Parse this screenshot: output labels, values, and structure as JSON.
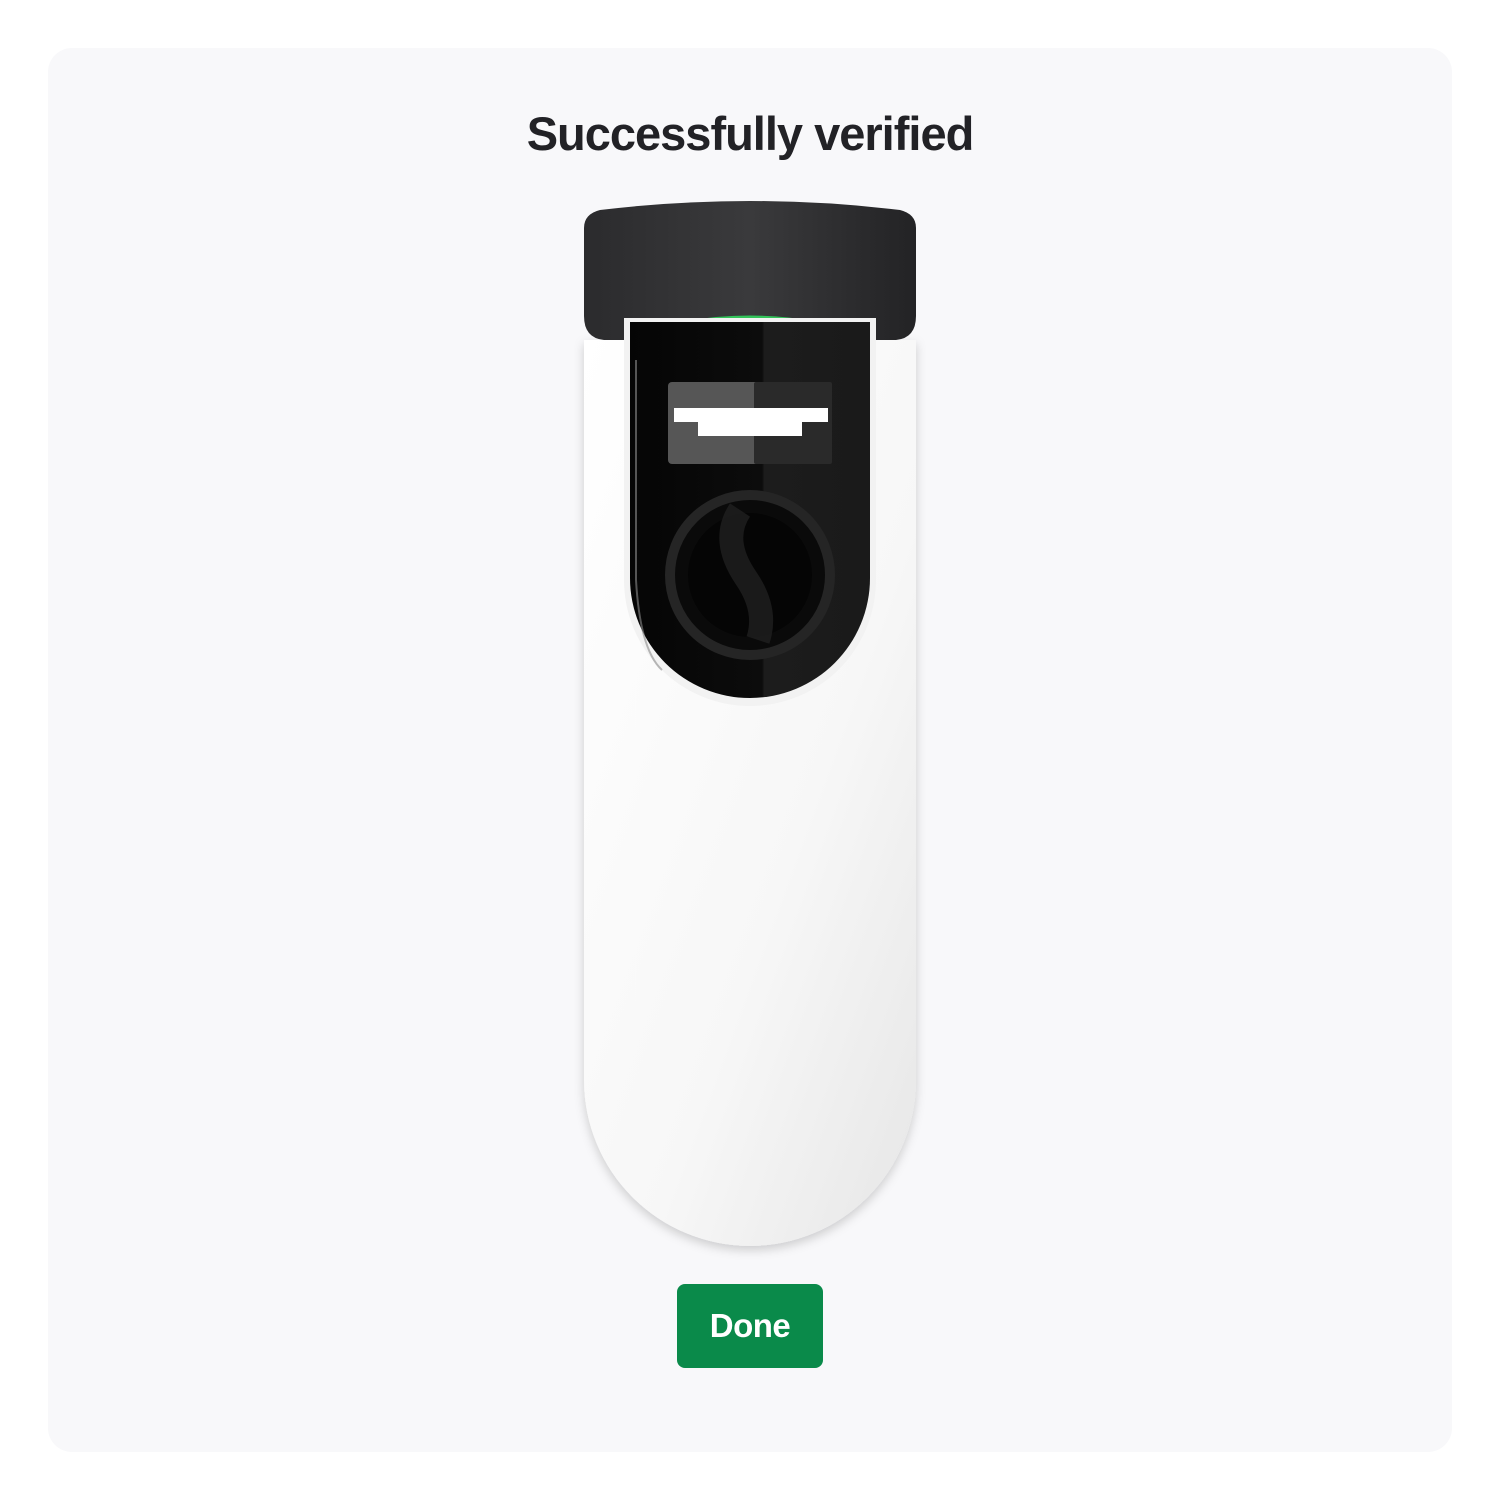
{
  "dialog": {
    "title": "Successfully verified",
    "done_label": "Done"
  },
  "device": {
    "illustration": "ev-charger-wallbox",
    "status_light_color": "#33c45a"
  },
  "colors": {
    "accent": "#0a8a4a",
    "title_text": "#222226",
    "card_background": "#f8f8fa"
  }
}
